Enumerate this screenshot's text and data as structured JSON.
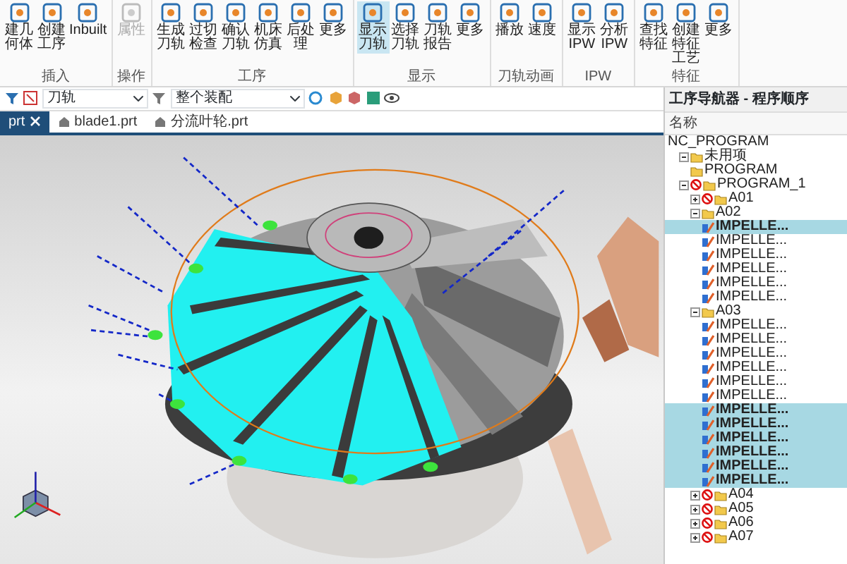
{
  "ribbon": {
    "groups": [
      {
        "label": "插入",
        "buttons": [
          {
            "label": "建几何体",
            "selected": false,
            "disabled": false
          },
          {
            "label": "创建工序",
            "selected": false,
            "disabled": false
          },
          {
            "label": "Inbuilt",
            "selected": false,
            "disabled": false
          }
        ]
      },
      {
        "label": "操作",
        "buttons": [
          {
            "label": "属性",
            "selected": false,
            "disabled": true
          }
        ]
      },
      {
        "label": "工序",
        "buttons": [
          {
            "label": "生成刀轨",
            "selected": false,
            "disabled": false
          },
          {
            "label": "过切检查",
            "selected": false,
            "disabled": false
          },
          {
            "label": "确认刀轨",
            "selected": false,
            "disabled": false
          },
          {
            "label": "机床仿真",
            "selected": false,
            "disabled": false
          },
          {
            "label": "后处理",
            "selected": false,
            "disabled": false
          },
          {
            "label": "更多",
            "selected": false,
            "disabled": false
          }
        ]
      },
      {
        "label": "显示",
        "buttons": [
          {
            "label": "显示刀轨",
            "selected": true,
            "disabled": false
          },
          {
            "label": "选择刀轨",
            "selected": false,
            "disabled": false
          },
          {
            "label": "刀轨报告",
            "selected": false,
            "disabled": false
          },
          {
            "label": "更多",
            "selected": false,
            "disabled": false
          }
        ]
      },
      {
        "label": "刀轨动画",
        "buttons": [
          {
            "label": "播放",
            "selected": false,
            "disabled": false
          },
          {
            "label": "速度",
            "selected": false,
            "disabled": false
          }
        ]
      },
      {
        "label": "IPW",
        "buttons": [
          {
            "label": "显示 IPW",
            "selected": false,
            "disabled": false
          },
          {
            "label": "分析 IPW",
            "selected": false,
            "disabled": false
          }
        ]
      },
      {
        "label": "特征",
        "buttons": [
          {
            "label": "查找特征",
            "selected": false,
            "disabled": false
          },
          {
            "label": "创建特征工艺",
            "selected": false,
            "disabled": false
          },
          {
            "label": "更多",
            "selected": false,
            "disabled": false
          }
        ]
      }
    ]
  },
  "toolbar": {
    "dropdowns": [
      {
        "value": "刀轨"
      },
      {
        "value": "整个装配"
      }
    ]
  },
  "file_tabs": [
    {
      "label": "prt",
      "selected": true
    },
    {
      "label": "blade1.prt",
      "selected": false
    },
    {
      "label": "分流叶轮.prt",
      "selected": false
    }
  ],
  "navigator": {
    "title": "工序导航器 - 程序顺序",
    "column": "名称",
    "tree": [
      {
        "label": "NC_PROGRAM",
        "kind": "root",
        "selected": false,
        "children": [
          {
            "label": "未用项",
            "kind": "group",
            "error": false,
            "expanded": true,
            "selected": false,
            "children": [
              {
                "label": "PROGRAM",
                "kind": "group",
                "error": false,
                "selected": false
              }
            ]
          },
          {
            "label": "PROGRAM_1",
            "kind": "group",
            "error": true,
            "expanded": true,
            "selected": false,
            "children": [
              {
                "label": "A01",
                "kind": "group",
                "error": true,
                "expanded": false,
                "selected": false
              },
              {
                "label": "A02",
                "kind": "group",
                "error": false,
                "expanded": true,
                "selected": false,
                "children": [
                  {
                    "label": "IMPELLE...",
                    "kind": "operation",
                    "selected": true
                  },
                  {
                    "label": "IMPELLE...",
                    "kind": "operation",
                    "selected": false
                  },
                  {
                    "label": "IMPELLE...",
                    "kind": "operation",
                    "selected": false
                  },
                  {
                    "label": "IMPELLE...",
                    "kind": "operation",
                    "selected": false
                  },
                  {
                    "label": "IMPELLE...",
                    "kind": "operation",
                    "selected": false
                  },
                  {
                    "label": "IMPELLE...",
                    "kind": "operation",
                    "selected": false
                  }
                ]
              },
              {
                "label": "A03",
                "kind": "group",
                "error": false,
                "expanded": true,
                "selected": false,
                "children": [
                  {
                    "label": "IMPELLE...",
                    "kind": "operation",
                    "selected": false
                  },
                  {
                    "label": "IMPELLE...",
                    "kind": "operation",
                    "selected": false
                  },
                  {
                    "label": "IMPELLE...",
                    "kind": "operation",
                    "selected": false
                  },
                  {
                    "label": "IMPELLE...",
                    "kind": "operation",
                    "selected": false
                  },
                  {
                    "label": "IMPELLE...",
                    "kind": "operation",
                    "selected": false
                  },
                  {
                    "label": "IMPELLE...",
                    "kind": "operation",
                    "selected": false
                  },
                  {
                    "label": "IMPELLE...",
                    "kind": "operation",
                    "selected": true
                  },
                  {
                    "label": "IMPELLE...",
                    "kind": "operation",
                    "selected": true
                  },
                  {
                    "label": "IMPELLE...",
                    "kind": "operation",
                    "selected": true
                  },
                  {
                    "label": "IMPELLE...",
                    "kind": "operation",
                    "selected": true
                  },
                  {
                    "label": "IMPELLE...",
                    "kind": "operation",
                    "selected": true
                  },
                  {
                    "label": "IMPELLE...",
                    "kind": "operation",
                    "selected": true
                  }
                ]
              },
              {
                "label": "A04",
                "kind": "group",
                "error": true,
                "expanded": false,
                "selected": false
              },
              {
                "label": "A05",
                "kind": "group",
                "error": true,
                "expanded": false,
                "selected": false
              },
              {
                "label": "A06",
                "kind": "group",
                "error": true,
                "expanded": false,
                "selected": false
              },
              {
                "label": "A07",
                "kind": "group",
                "error": true,
                "expanded": false,
                "selected": false
              }
            ]
          }
        ]
      }
    ]
  }
}
